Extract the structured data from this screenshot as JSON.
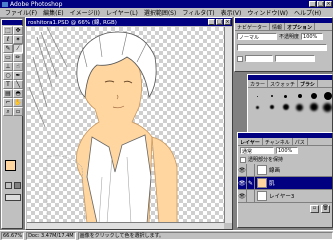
{
  "app": {
    "title": "Adobe Photoshop"
  },
  "menu": [
    "ファイル(F)",
    "編集(E)",
    "イメージ(I)",
    "レイヤー(L)",
    "選択範囲(S)",
    "フィルタ(T)",
    "表示(V)",
    "ウィンドウ(W)",
    "ヘルプ(H)"
  ],
  "document": {
    "title": "roshitora1.PSD @ 66% (線, RGB)"
  },
  "navigator": {
    "tabs": [
      "ナビゲーター",
      "情報",
      "オプション"
    ],
    "mode": "ノーマル",
    "opacity_label": "不透明度",
    "opacity": "100%"
  },
  "brushes": {
    "tabs": [
      "カラー",
      "スウォッチ",
      "ブラシ"
    ]
  },
  "layers": {
    "tabs": [
      "レイヤー",
      "チャンネル",
      "パス"
    ],
    "mode": "通常",
    "opacity": "100%",
    "preserve_label": "透明部分を保持",
    "items": [
      {
        "name": "線画",
        "selected": false
      },
      {
        "name": "肌",
        "selected": true
      },
      {
        "name": "レイヤー3",
        "selected": false
      }
    ]
  },
  "status": {
    "zoom": "66.67%",
    "doc": "Doc: 3.47M/17.4M",
    "hint": "画像をクリックして色を選択します。"
  },
  "colors": {
    "titlebar": "#000080",
    "skin": "#ffd6a0",
    "face": "#c0c0c0"
  }
}
